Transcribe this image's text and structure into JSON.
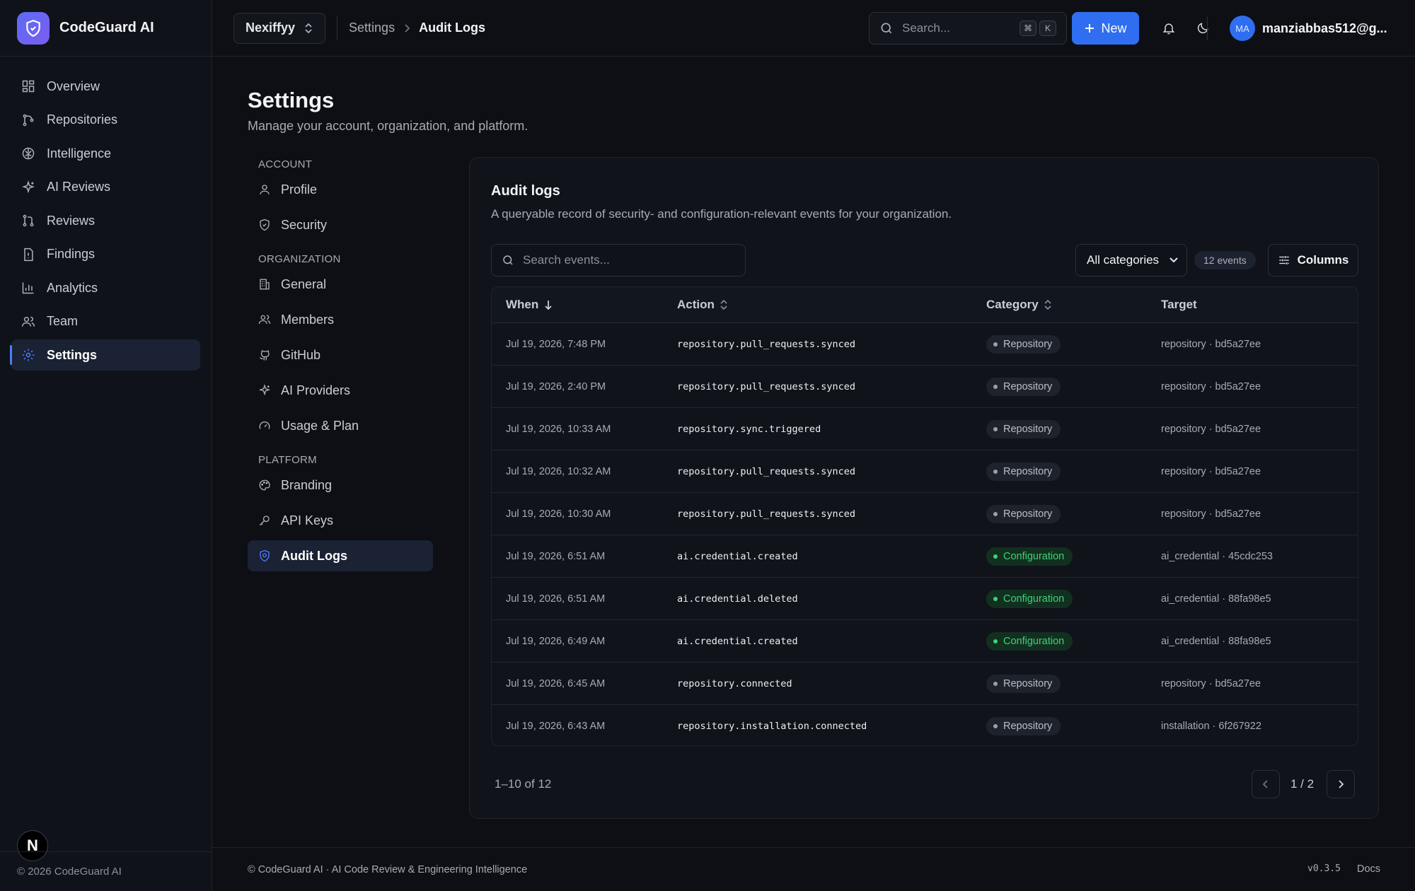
{
  "brand": {
    "name": "CodeGuard AI",
    "footer": "© 2026 CodeGuard AI",
    "badge": "N"
  },
  "sidebar": {
    "items": [
      {
        "label": "Overview",
        "icon": "grid-icon"
      },
      {
        "label": "Repositories",
        "icon": "git-branch-icon"
      },
      {
        "label": "Intelligence",
        "icon": "brain-icon"
      },
      {
        "label": "AI Reviews",
        "icon": "sparkles-icon"
      },
      {
        "label": "Reviews",
        "icon": "git-pull-request-icon"
      },
      {
        "label": "Findings",
        "icon": "alert-file-icon"
      },
      {
        "label": "Analytics",
        "icon": "bar-chart-icon"
      },
      {
        "label": "Team",
        "icon": "users-icon"
      },
      {
        "label": "Settings",
        "icon": "gear-icon",
        "active": true
      }
    ]
  },
  "topbar": {
    "org": "Nexiffyy",
    "breadcrumb": [
      "Settings",
      "Audit Logs"
    ],
    "search_placeholder": "Search...",
    "kbd": [
      "⌘",
      "K"
    ],
    "new_label": "New",
    "user": {
      "initials": "MA",
      "name": "manziabbas512@g..."
    }
  },
  "page": {
    "title": "Settings",
    "subtitle": "Manage your account, organization, and platform."
  },
  "settings_nav": [
    {
      "group": "ACCOUNT",
      "items": [
        {
          "label": "Profile",
          "icon": "user-icon"
        },
        {
          "label": "Security",
          "icon": "shield-icon"
        }
      ]
    },
    {
      "group": "ORGANIZATION",
      "items": [
        {
          "label": "General",
          "icon": "building-icon"
        },
        {
          "label": "Members",
          "icon": "users-icon"
        },
        {
          "label": "GitHub",
          "icon": "github-icon"
        },
        {
          "label": "AI Providers",
          "icon": "sparkles-icon"
        },
        {
          "label": "Usage & Plan",
          "icon": "gauge-icon"
        }
      ]
    },
    {
      "group": "PLATFORM",
      "items": [
        {
          "label": "Branding",
          "icon": "palette-icon"
        },
        {
          "label": "API Keys",
          "icon": "key-icon"
        },
        {
          "label": "Audit Logs",
          "icon": "file-shield-icon",
          "active": true
        }
      ]
    }
  ],
  "audit": {
    "title": "Audit logs",
    "subtitle": "A queryable record of security- and configuration-relevant events for your organization.",
    "search_placeholder": "Search events...",
    "category_filter": "All categories",
    "event_count": "12 events",
    "columns_label": "Columns",
    "headers": {
      "when": "When",
      "action": "Action",
      "category": "Category",
      "target": "Target"
    },
    "rows": [
      {
        "when": "Jul 19, 2026, 7:48 PM",
        "action": "repository.pull_requests.synced",
        "category": "Repository",
        "target": "repository · bd5a27ee"
      },
      {
        "when": "Jul 19, 2026, 2:40 PM",
        "action": "repository.pull_requests.synced",
        "category": "Repository",
        "target": "repository · bd5a27ee"
      },
      {
        "when": "Jul 19, 2026, 10:33 AM",
        "action": "repository.sync.triggered",
        "category": "Repository",
        "target": "repository · bd5a27ee"
      },
      {
        "when": "Jul 19, 2026, 10:32 AM",
        "action": "repository.pull_requests.synced",
        "category": "Repository",
        "target": "repository · bd5a27ee"
      },
      {
        "when": "Jul 19, 2026, 10:30 AM",
        "action": "repository.pull_requests.synced",
        "category": "Repository",
        "target": "repository · bd5a27ee"
      },
      {
        "when": "Jul 19, 2026, 6:51 AM",
        "action": "ai.credential.created",
        "category": "Configuration",
        "target": "ai_credential · 45cdc253"
      },
      {
        "when": "Jul 19, 2026, 6:51 AM",
        "action": "ai.credential.deleted",
        "category": "Configuration",
        "target": "ai_credential · 88fa98e5"
      },
      {
        "when": "Jul 19, 2026, 6:49 AM",
        "action": "ai.credential.created",
        "category": "Configuration",
        "target": "ai_credential · 88fa98e5"
      },
      {
        "when": "Jul 19, 2026, 6:45 AM",
        "action": "repository.connected",
        "category": "Repository",
        "target": "repository · bd5a27ee"
      },
      {
        "when": "Jul 19, 2026, 6:43 AM",
        "action": "repository.installation.connected",
        "category": "Repository",
        "target": "installation · 6f267922"
      }
    ],
    "pagination": {
      "range": "1–10 of 12",
      "page": "1 / 2"
    }
  },
  "footer": {
    "text": "© CodeGuard AI · AI Code Review & Engineering Intelligence",
    "version": "v0.3.5",
    "docs": "Docs"
  },
  "colors": {
    "accent": "#2f6ef0",
    "config_badge": "#3ed27a",
    "background": "#0d0f14"
  }
}
